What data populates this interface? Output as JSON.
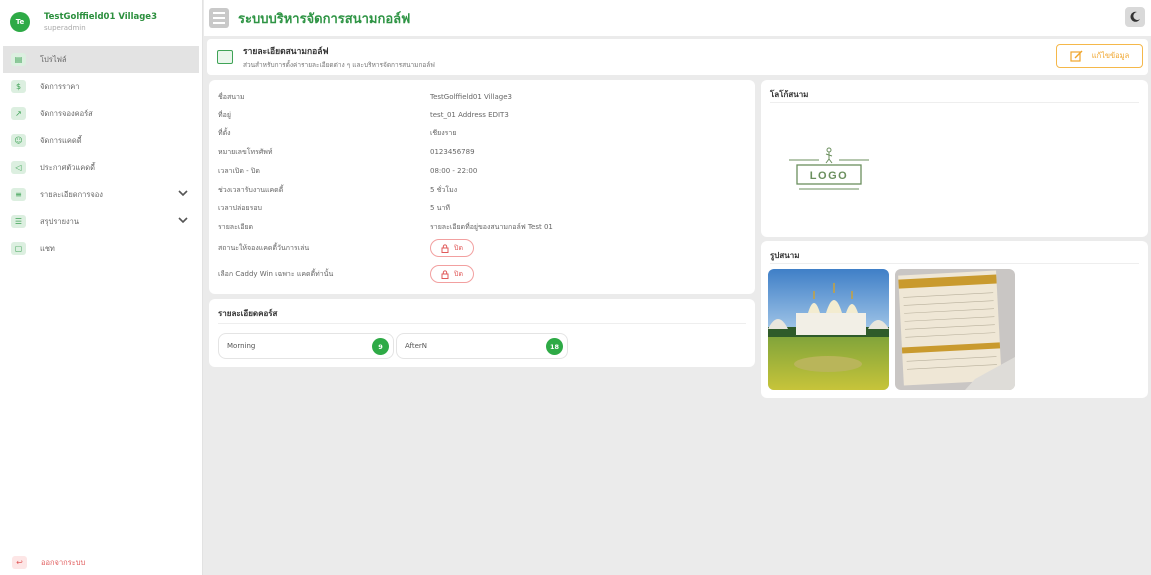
{
  "user": {
    "initials": "Te",
    "name": "TestGolffield01 Village3",
    "role": "superadmin"
  },
  "menu": [
    {
      "label": "โปรไฟล์",
      "icon": "profile-icon",
      "active": true
    },
    {
      "label": "จัดการราคา",
      "icon": "price-icon"
    },
    {
      "label": "จัดการจองคอร์ส",
      "icon": "chart-icon"
    },
    {
      "label": "จัดการแคดดี้",
      "icon": "caddy-icon"
    },
    {
      "label": "ประกาศตัวแคดดี้",
      "icon": "announce-icon"
    },
    {
      "label": "รายละเอียดการจอง",
      "icon": "list-icon",
      "expandable": true
    },
    {
      "label": "สรุปรายงาน",
      "icon": "report-icon",
      "expandable": true
    },
    {
      "label": "แชท",
      "icon": "chat-icon"
    }
  ],
  "logout_label": "ออกจากระบบ",
  "header": {
    "title": "ระบบบริหารจัดการสนามกอล์ฟ"
  },
  "page": {
    "title": "รายละเอียดสนามกอล์ฟ",
    "subtitle": "ส่วนสำหรับการตั้งค่ารายละเอียดต่าง ๆ และบริหารจัดการสนามกอล์ฟ",
    "edit_label": "แก้ไขข้อมูล"
  },
  "details": [
    {
      "label": "ชื่อสนาม",
      "value": "TestGolffield01 Village3"
    },
    {
      "label": "ที่อยู่",
      "value": "test_01 Address EDIT3"
    },
    {
      "label": "ที่ตั้ง",
      "value": "เชียงราย"
    },
    {
      "label": "หมายเลขโทรศัพท์",
      "value": "0123456789"
    },
    {
      "label": "เวลาเปิด - ปิด",
      "value": "08:00 - 22:00"
    },
    {
      "label": "ช่วงเวลารับงานแคดดี้",
      "value": "5 ชั่วโมง"
    },
    {
      "label": "เวลาปล่อยรอบ",
      "value": "5 นาที"
    },
    {
      "label": "รายละเอียด",
      "value": "รายละเอียดที่อยู่ของสนามกอล์ฟ Test 01"
    }
  ],
  "toggles": [
    {
      "label": "สถานะให้จองแคดดี้วันการเล่น",
      "value": "ปิด"
    },
    {
      "label": "เลือก Caddy Win เฉพาะ แคดดี้ท่านั้น",
      "value": "ปิด"
    }
  ],
  "courses": {
    "title": "รายละเอียดคอร์ส",
    "items": [
      {
        "name": "Morning",
        "holes": "9"
      },
      {
        "name": "AfterN",
        "holes": "18"
      }
    ]
  },
  "logo_section": {
    "title": "โลโก้สนาม",
    "logo_text": "LOGO"
  },
  "photo_section": {
    "title": "รูปสนาม"
  },
  "colors": {
    "primary": "#2eaa46",
    "accent": "#f0a52c",
    "danger": "#e05a5a"
  }
}
